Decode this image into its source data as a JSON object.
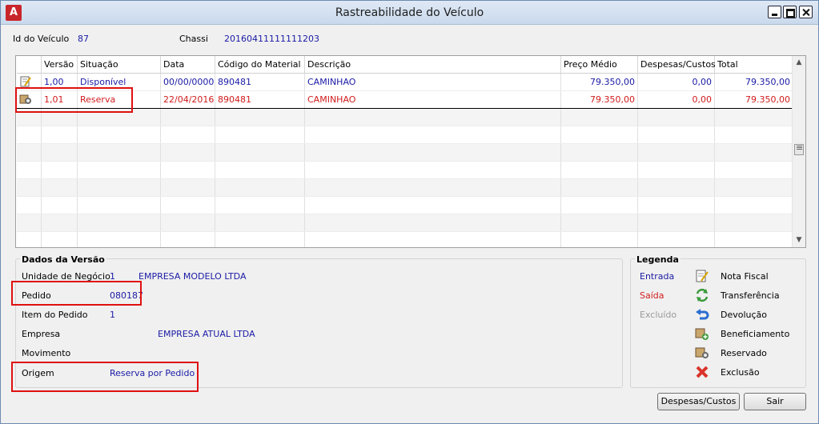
{
  "window": {
    "title": "Rastreabilidade do Veículo"
  },
  "header": {
    "id_label": "Id do Veículo",
    "id_value": "87",
    "chassi_label": "Chassi",
    "chassi_value": "20160411111111203"
  },
  "grid": {
    "columns": [
      "Versão",
      "Situação",
      "Data",
      "Código do Material",
      "Descrição",
      "Preço Médio",
      "Despesas/Custos",
      "Total"
    ],
    "rows": [
      {
        "icon": "edit-note-icon",
        "versao": "1,00",
        "situacao": "Disponível",
        "data": "00/00/0000",
        "codigo": "890481",
        "descricao": "CAMINHAO",
        "preco": "79.350,00",
        "despesas": "0,00",
        "total": "79.350,00"
      },
      {
        "icon": "reserved-icon",
        "versao": "1,01",
        "situacao": "Reserva",
        "data": "22/04/2016",
        "codigo": "890481",
        "descricao": "CAMINHAO",
        "preco": "79.350,00",
        "despesas": "0,00",
        "total": "79.350,00"
      }
    ],
    "empty_rows": 8
  },
  "dados": {
    "title": "Dados da Versão",
    "unidade_label": "Unidade de Negócio",
    "unidade_code": "1",
    "unidade_name": "EMPRESA MODELO LTDA",
    "pedido_label": "Pedido",
    "pedido_value": "080187",
    "item_label": "Item do Pedido",
    "item_value": "1",
    "empresa_label": "Empresa",
    "empresa_value": "EMPRESA ATUAL LTDA",
    "movimento_label": "Movimento",
    "origem_label": "Origem",
    "origem_value": "Reserva por Pedido"
  },
  "legenda": {
    "title": "Legenda",
    "states": [
      {
        "label": "Entrada",
        "color": "#1a1aa6"
      },
      {
        "label": "Saída",
        "color": "#d11c1c"
      },
      {
        "label": "Excluído",
        "color": "#9a9a9a"
      }
    ],
    "items": [
      {
        "label": "Nota Fiscal",
        "icon": "invoice-icon"
      },
      {
        "label": "Transferência",
        "icon": "transfer-icon"
      },
      {
        "label": "Devolução",
        "icon": "return-icon"
      },
      {
        "label": "Beneficiamento",
        "icon": "processing-icon"
      },
      {
        "label": "Reservado",
        "icon": "reserved-icon"
      },
      {
        "label": "Exclusão",
        "icon": "delete-x-icon"
      }
    ]
  },
  "buttons": {
    "despesas": "Despesas/Custos",
    "sair": "Sair"
  }
}
